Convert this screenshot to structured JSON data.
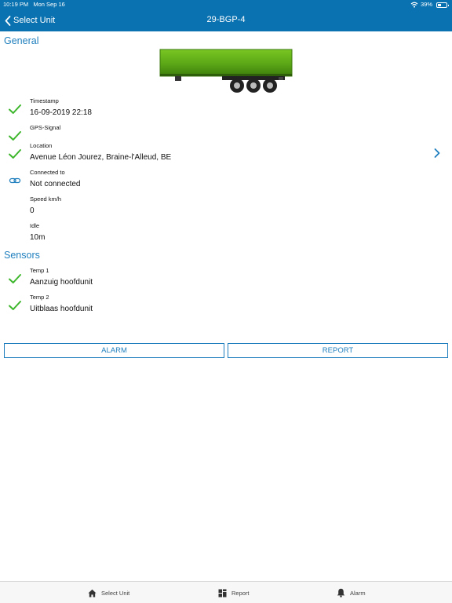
{
  "status_bar": {
    "time": "10:19 PM",
    "date": "Mon Sep 16",
    "battery": "39%",
    "battery_level": 0.39
  },
  "nav": {
    "back_label": "Select Unit",
    "title": "29-BGP-4"
  },
  "general": {
    "title": "General",
    "rows": [
      {
        "label": "Timestamp",
        "value": "16-09-2019 22:18",
        "icon": "check-icon"
      },
      {
        "label": "GPS-Signal",
        "value": "",
        "icon": "check-icon"
      },
      {
        "label": "Location",
        "value": "Avenue Léon Jourez, Braine-l'Alleud, BE",
        "icon": "check-icon"
      },
      {
        "label": "Connected to",
        "value": "Not connected",
        "icon": "link-icon"
      },
      {
        "label": "Speed km/h",
        "value": "0",
        "icon": ""
      },
      {
        "label": "Idle",
        "value": "10m",
        "icon": ""
      }
    ]
  },
  "sensors": {
    "title": "Sensors",
    "rows": [
      {
        "label": "Temp 1",
        "value": "Aanzuig hoofdunit",
        "icon": "check-icon"
      },
      {
        "label": "Temp 2",
        "value": "Uitblaas hoofdunit",
        "icon": "check-icon"
      }
    ]
  },
  "buttons": {
    "alarm": "ALARM",
    "report": "REPORT"
  },
  "tabs": [
    {
      "label": "Select Unit",
      "icon": "home-icon"
    },
    {
      "label": "Report",
      "icon": "report-icon"
    },
    {
      "label": "Alarm",
      "icon": "bell-icon"
    }
  ],
  "colors": {
    "header": "#0a72b0",
    "accent": "#1f7fbe",
    "check": "#3cb62b",
    "trailer": "#5fb31c"
  }
}
